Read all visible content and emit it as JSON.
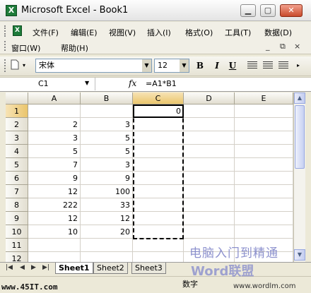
{
  "window": {
    "title": "Microsoft Excel - Book1",
    "app_icon": "X"
  },
  "menu": {
    "row1": [
      "文件(F)",
      "编辑(E)",
      "视图(V)",
      "插入(I)",
      "格式(O)",
      "工具(T)",
      "数据(D)"
    ],
    "row2": [
      "窗口(W)",
      "帮助(H)"
    ],
    "mdi_buttons": [
      "_",
      "⧉",
      "×"
    ]
  },
  "toolbar": {
    "font": "宋体",
    "size": "12",
    "bold": "B",
    "italic": "I",
    "underline": "U"
  },
  "formula_bar": {
    "name_box": "C1",
    "fx": "fx",
    "formula": "=A1*B1"
  },
  "grid": {
    "columns": [
      "A",
      "B",
      "C",
      "D",
      "E"
    ],
    "selected_column": "C",
    "rows": [
      {
        "n": "1",
        "a": "",
        "b": "",
        "c": "0"
      },
      {
        "n": "2",
        "a": "2",
        "b": "3",
        "c": ""
      },
      {
        "n": "3",
        "a": "3",
        "b": "5",
        "c": ""
      },
      {
        "n": "4",
        "a": "5",
        "b": "5",
        "c": ""
      },
      {
        "n": "5",
        "a": "7",
        "b": "3",
        "c": ""
      },
      {
        "n": "6",
        "a": "9",
        "b": "9",
        "c": ""
      },
      {
        "n": "7",
        "a": "12",
        "b": "100",
        "c": ""
      },
      {
        "n": "8",
        "a": "222",
        "b": "33",
        "c": ""
      },
      {
        "n": "9",
        "a": "12",
        "b": "12",
        "c": ""
      },
      {
        "n": "10",
        "a": "10",
        "b": "20",
        "c": ""
      },
      {
        "n": "11",
        "a": "",
        "b": "",
        "c": ""
      },
      {
        "n": "12",
        "a": "",
        "b": "",
        "c": ""
      }
    ]
  },
  "sheets": [
    "Sheet1",
    "Sheet2",
    "Sheet3"
  ],
  "status": {
    "mode": "数字"
  },
  "watermarks": {
    "left": "www.45IT.com",
    "site_cn": "电脑入门到精通",
    "site_word": "Word联盟",
    "url": "www.wordlm.com"
  }
}
